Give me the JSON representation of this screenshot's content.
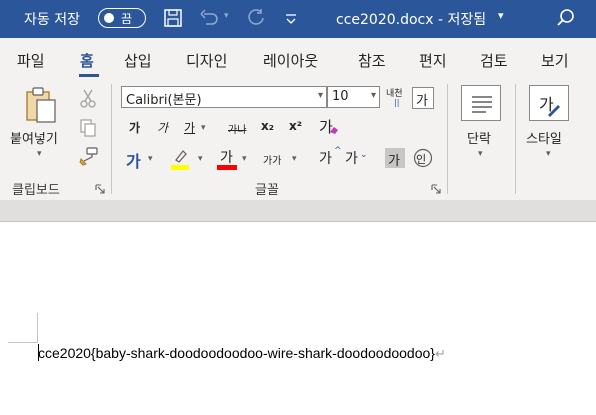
{
  "titlebar": {
    "autosave_label": "자동 저장",
    "autosave_state": "끔",
    "doc_title": "cce2020.docx  -  저장됨",
    "title_caret": "▾"
  },
  "tabs": [
    {
      "label": "파일"
    },
    {
      "label": "홈"
    },
    {
      "label": "삽입"
    },
    {
      "label": "디자인"
    },
    {
      "label": "레이아웃"
    },
    {
      "label": "참조"
    },
    {
      "label": "편지"
    },
    {
      "label": "검토"
    },
    {
      "label": "보기"
    }
  ],
  "ribbon": {
    "clipboard": {
      "paste_label": "붙여넣기",
      "group_label": "클립보드"
    },
    "font": {
      "font_name": "Calibri(본문)",
      "font_size": "10",
      "group_label": "글꼴",
      "bold": "가",
      "italic": "가",
      "underline": "가",
      "strike": "가나",
      "subscript": "x₂",
      "superscript": "x²",
      "clear_format": "가",
      "text_effect": "가",
      "font_color": "가",
      "char_size": "가가",
      "change_case": "가",
      "grow_shrink_label": "내천",
      "phonetic": "가",
      "char_shading": "가",
      "enclosed": "인"
    },
    "paragraph": {
      "label": "단락"
    },
    "styles": {
      "label": "스타일"
    },
    "colors": {
      "accent": "#2b579a",
      "highlight": "#ffff00",
      "font_color": "#ff0000"
    }
  },
  "document": {
    "text": "cce2020{baby-shark-doodoodoodoo-wire-shark-doodoodoodoo}",
    "para_mark": "↵"
  }
}
